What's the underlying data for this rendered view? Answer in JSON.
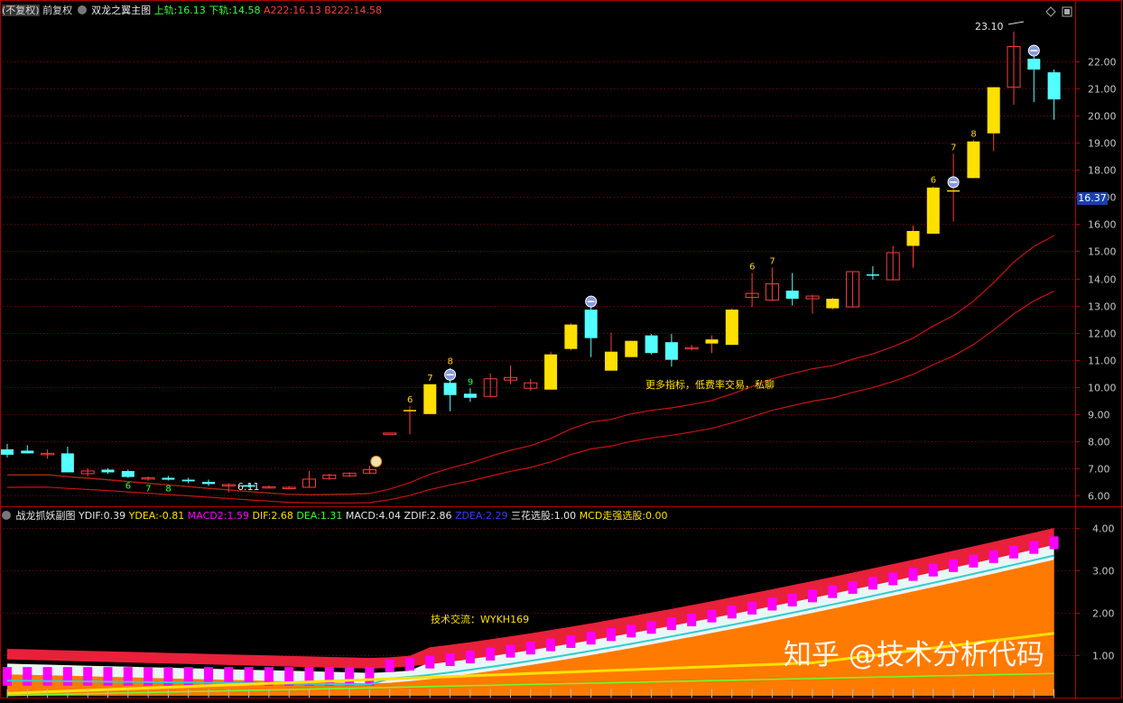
{
  "main_panel": {
    "prefix": "(不复权)",
    "adjust_mode": "前复权",
    "title": "双龙之翼主图",
    "upper_label": "上轨:",
    "upper_value": "16.13",
    "lower_label": "下轨:",
    "lower_value": "14.58",
    "a_label": "A222:",
    "a_value": "16.13",
    "b_label": "B222:",
    "b_value": "14.58",
    "current_price": "16.37",
    "high_marker": "23.10",
    "low_marker": "6.11",
    "note": "更多指标，低费率交易，私聊",
    "y_ticks": [
      "22.00",
      "21.00",
      "20.00",
      "19.00",
      "18.00",
      "17.00",
      "16.00",
      "15.00",
      "14.00",
      "13.00",
      "12.00",
      "11.00",
      "10.00",
      "9.00",
      "8.00",
      "7.00",
      "6.00"
    ],
    "y_range": [
      5.6,
      23.6
    ]
  },
  "sub_panel": {
    "title": "战龙抓妖副图",
    "ydif_label": "YDIF:",
    "ydif_value": "0.39",
    "ydea_label": "YDEA:",
    "ydea_value": "-0.81",
    "macd2_label": "MACD2:",
    "macd2_value": "1.59",
    "dif_label": "DIF:",
    "dif_value": "2.68",
    "dea_label": "DEA:",
    "dea_value": "1.31",
    "macd_label": "MACD:",
    "macd_value": "4.04",
    "zdif_label": "ZDIF:",
    "zdif_value": "2.86",
    "zdea_label": "ZDEA:",
    "zdea_value": "2.29",
    "sanhua_label": "三花选股:",
    "sanhua_value": "1.00",
    "mcd_label": "MCD走强选股:",
    "mcd_value": "0.00",
    "note": "技术交流：WYKH169",
    "y_ticks": [
      "4.00",
      "3.00",
      "2.00",
      "1.00"
    ],
    "y_range": [
      0.0,
      4.15
    ]
  },
  "watermark": "知乎 @技术分析代码",
  "candles": [
    {
      "o": 7.7,
      "h": 7.9,
      "l": 7.4,
      "c": 7.5
    },
    {
      "o": 7.65,
      "h": 7.85,
      "l": 7.55,
      "c": 7.55
    },
    {
      "o": 7.5,
      "h": 7.7,
      "l": 7.35,
      "c": 7.55
    },
    {
      "o": 7.55,
      "h": 7.8,
      "l": 6.85,
      "c": 6.85
    },
    {
      "o": 6.8,
      "h": 7.0,
      "l": 6.7,
      "c": 6.9
    },
    {
      "o": 6.95,
      "h": 7.0,
      "l": 6.8,
      "c": 6.85
    },
    {
      "o": 6.9,
      "h": 6.95,
      "l": 6.65,
      "c": 6.68
    },
    {
      "o": 6.62,
      "h": 6.7,
      "l": 6.55,
      "c": 6.65
    },
    {
      "o": 6.65,
      "h": 6.72,
      "l": 6.55,
      "c": 6.58
    },
    {
      "o": 6.58,
      "h": 6.65,
      "l": 6.45,
      "c": 6.52
    },
    {
      "o": 6.5,
      "h": 6.58,
      "l": 6.35,
      "c": 6.42
    },
    {
      "o": 6.35,
      "h": 6.45,
      "l": 6.11,
      "c": 6.4
    },
    {
      "o": 6.38,
      "h": 6.42,
      "l": 6.3,
      "c": 6.32
    },
    {
      "o": 6.32,
      "h": 6.36,
      "l": 6.28,
      "c": 6.32
    },
    {
      "o": 6.3,
      "h": 6.34,
      "l": 6.26,
      "c": 6.3
    },
    {
      "o": 6.3,
      "h": 6.9,
      "l": 6.3,
      "c": 6.6
    },
    {
      "o": 6.62,
      "h": 6.8,
      "l": 6.58,
      "c": 6.75
    },
    {
      "o": 6.72,
      "h": 6.85,
      "l": 6.68,
      "c": 6.82
    },
    {
      "o": 6.82,
      "h": 7.1,
      "l": 6.8,
      "c": 6.95
    },
    {
      "o": 8.3,
      "h": 8.3,
      "l": 8.3,
      "c": 8.3
    },
    {
      "o": 9.1,
      "h": 9.3,
      "l": 8.25,
      "c": 9.15
    },
    {
      "o": 9.0,
      "h": 10.1,
      "l": 9.0,
      "c": 10.1
    },
    {
      "o": 10.15,
      "h": 10.7,
      "l": 9.1,
      "c": 9.7
    },
    {
      "o": 9.75,
      "h": 9.95,
      "l": 9.45,
      "c": 9.6
    },
    {
      "o": 9.65,
      "h": 10.5,
      "l": 9.65,
      "c": 10.3
    },
    {
      "o": 10.25,
      "h": 10.8,
      "l": 10.1,
      "c": 10.35
    },
    {
      "o": 9.95,
      "h": 10.3,
      "l": 9.85,
      "c": 10.15
    },
    {
      "o": 9.9,
      "h": 11.3,
      "l": 9.9,
      "c": 11.2
    },
    {
      "o": 11.4,
      "h": 12.35,
      "l": 11.35,
      "c": 12.3
    },
    {
      "o": 12.85,
      "h": 13.0,
      "l": 11.1,
      "c": 11.8
    },
    {
      "o": 11.3,
      "h": 12.0,
      "l": 10.6,
      "c": 10.6
    },
    {
      "o": 11.1,
      "h": 11.7,
      "l": 11.1,
      "c": 11.7
    },
    {
      "o": 11.9,
      "h": 11.95,
      "l": 11.2,
      "c": 11.25
    },
    {
      "o": 11.65,
      "h": 11.95,
      "l": 10.75,
      "c": 11.0
    },
    {
      "o": 11.45,
      "h": 11.55,
      "l": 11.35,
      "c": 11.45
    },
    {
      "o": 11.6,
      "h": 11.9,
      "l": 11.25,
      "c": 11.75
    },
    {
      "o": 11.55,
      "h": 12.9,
      "l": 11.55,
      "c": 12.85
    },
    {
      "o": 13.3,
      "h": 14.2,
      "l": 12.95,
      "c": 13.45
    },
    {
      "o": 13.2,
      "h": 14.4,
      "l": 13.2,
      "c": 13.8
    },
    {
      "o": 13.55,
      "h": 14.2,
      "l": 13.0,
      "c": 13.25
    },
    {
      "o": 13.25,
      "h": 13.4,
      "l": 12.7,
      "c": 13.35
    },
    {
      "o": 13.25,
      "h": 13.3,
      "l": 12.85,
      "c": 12.9
    },
    {
      "o": 12.95,
      "h": 14.25,
      "l": 12.95,
      "c": 14.25
    },
    {
      "o": 14.15,
      "h": 14.45,
      "l": 13.95,
      "c": 14.1
    },
    {
      "o": 13.95,
      "h": 15.2,
      "l": 13.95,
      "c": 14.95
    },
    {
      "o": 15.2,
      "h": 15.95,
      "l": 14.4,
      "c": 15.75
    },
    {
      "o": 15.65,
      "h": 17.4,
      "l": 15.65,
      "c": 17.35
    },
    {
      "o": 17.25,
      "h": 18.6,
      "l": 16.1,
      "c": 17.25
    },
    {
      "o": 17.7,
      "h": 19.1,
      "l": 17.7,
      "c": 19.05
    },
    {
      "o": 19.35,
      "h": 21.05,
      "l": 18.7,
      "c": 21.05
    },
    {
      "o": 21.05,
      "h": 23.1,
      "l": 20.4,
      "c": 22.55
    },
    {
      "o": 22.1,
      "h": 22.5,
      "l": 20.5,
      "c": 21.7
    },
    {
      "o": 21.6,
      "h": 21.7,
      "l": 19.85,
      "c": 20.6
    }
  ],
  "yellow_candles": [
    20,
    21,
    27,
    28,
    30,
    31,
    35,
    36,
    41,
    45,
    46,
    47,
    48,
    49
  ],
  "candle_labels": [
    {
      "i": 20,
      "t": "6",
      "c": "#ffd21f"
    },
    {
      "i": 21,
      "t": "7",
      "c": "#ffd21f"
    },
    {
      "i": 22,
      "t": "8",
      "c": "#ffd21f"
    },
    {
      "i": 23,
      "t": "9",
      "c": "#33ff33"
    },
    {
      "i": 37,
      "t": "6",
      "c": "#ffd21f"
    },
    {
      "i": 38,
      "t": "7",
      "c": "#ffd21f"
    },
    {
      "i": 46,
      "t": "6",
      "c": "#ffd21f"
    },
    {
      "i": 47,
      "t": "7",
      "c": "#ffd21f"
    },
    {
      "i": 48,
      "t": "8",
      "c": "#ffd21f"
    },
    {
      "i": 6,
      "t": "6",
      "c": "#33ff33"
    },
    {
      "i": 7,
      "t": "7",
      "c": "#33ff33"
    },
    {
      "i": 8,
      "t": "8",
      "c": "#33ff33"
    }
  ],
  "signal_icons": [
    22,
    29,
    47,
    51
  ],
  "colors": {
    "bg": "#000000",
    "up": "#ff3c3c",
    "down": "#54ffff",
    "yellow": "#ffe000",
    "grid": "#8a0000",
    "axis": "#b00000",
    "ma_green": "#00b400",
    "ma_red": "#cc1111",
    "macd_bar": "#ff00ff",
    "area_orange": "#ff7a00",
    "area_white": "#e8f6f6",
    "area_red": "#e8203a"
  }
}
